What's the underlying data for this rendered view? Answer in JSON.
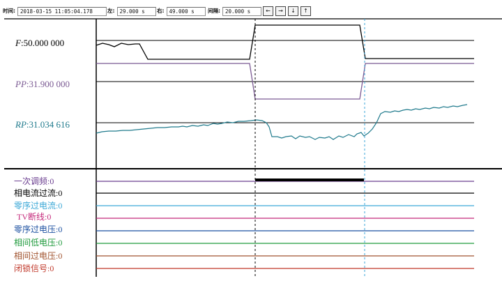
{
  "toolbar": {
    "time_label": "时间:",
    "time_value": "2018-03-15 11:05:04.178",
    "left_label": "左:",
    "left_value": "29.000 s",
    "right_label": "右:",
    "right_value": "49.000 s",
    "interval_label": "间隔:",
    "interval_value": "20.000 s",
    "buttons": [
      {
        "icon": "arrow-left-icon",
        "glyph": "←"
      },
      {
        "icon": "arrow-right-icon",
        "glyph": "→"
      },
      {
        "icon": "arrow-down-icon",
        "glyph": "↓"
      },
      {
        "icon": "arrow-up-icon",
        "glyph": "↑"
      }
    ]
  },
  "analog_channels": [
    {
      "name": "F",
      "value": "50.000 000",
      "color": "#000000"
    },
    {
      "name": "PP",
      "value": "31.900 000",
      "color": "#7b5a93"
    },
    {
      "name": "RP",
      "value": "31.034 616",
      "color": "#1f7a8c"
    }
  ],
  "digital_channels": [
    {
      "name": "一次调频",
      "value": "0",
      "color": "#6a3d8f"
    },
    {
      "name": "相电流过流",
      "value": "0",
      "color": "#000000"
    },
    {
      "name": "零序过电流",
      "value": "0",
      "color": "#39a7d6"
    },
    {
      "name": "TV断线",
      "value": "0",
      "color": "#c4287a"
    },
    {
      "name": "零序过电压",
      "value": "0",
      "color": "#1a4fa0"
    },
    {
      "name": "相间低电压",
      "value": "0",
      "color": "#1f9a3c"
    },
    {
      "name": "相间过电压",
      "value": "0",
      "color": "#a0522d"
    },
    {
      "name": "闭锁信号",
      "value": "0",
      "color": "#c0392b"
    }
  ],
  "separator": ":",
  "cursor_colors": {
    "left": "#000000",
    "right": "#3aa6d8"
  }
}
